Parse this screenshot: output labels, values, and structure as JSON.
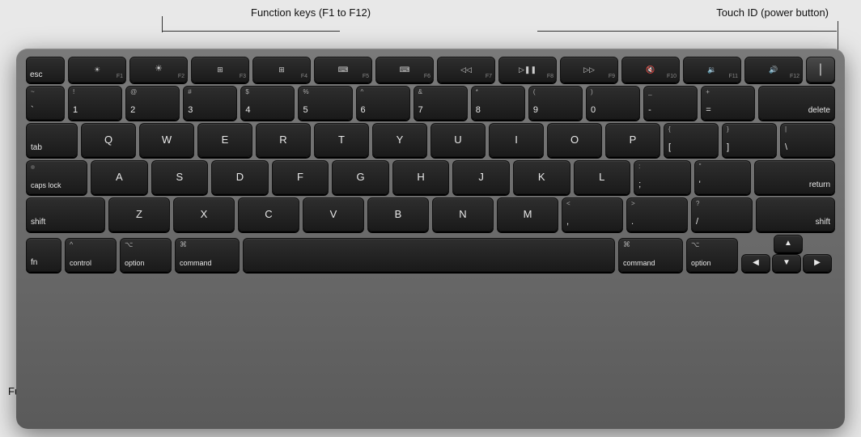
{
  "annotations": {
    "function_keys_label": "Function keys (F1 to F12)",
    "touchid_label": "Touch ID (power button)",
    "fn_key_label": "Function (Fn) key"
  },
  "keyboard": {
    "rows": {
      "fn_row": [
        "esc",
        "F1",
        "F2",
        "F3",
        "F4",
        "F5",
        "F6",
        "F7",
        "F8",
        "F9",
        "F10",
        "F11",
        "F12",
        "⏻"
      ],
      "num_row": [
        {
          "top": "~",
          "bottom": "`"
        },
        {
          "top": "!",
          "bottom": "1"
        },
        {
          "top": "@",
          "bottom": "2"
        },
        {
          "top": "#",
          "bottom": "3"
        },
        {
          "top": "$",
          "bottom": "4"
        },
        {
          "top": "%",
          "bottom": "5"
        },
        {
          "top": "^",
          "bottom": "6"
        },
        {
          "top": "&",
          "bottom": "7"
        },
        {
          "top": "*",
          "bottom": "8"
        },
        {
          "top": "(",
          "bottom": "9"
        },
        {
          "top": ")",
          "bottom": "0"
        },
        {
          "top": "_",
          "bottom": "-"
        },
        {
          "top": "+",
          "bottom": "="
        },
        "delete"
      ],
      "tab_row": [
        "tab",
        "Q",
        "W",
        "E",
        "R",
        "T",
        "Y",
        "U",
        "I",
        "O",
        "P",
        "{[",
        "}]",
        "|\\"
      ],
      "caps_row": [
        "caps lock",
        "A",
        "S",
        "D",
        "F",
        "G",
        "H",
        "J",
        "K",
        "L",
        ";:",
        "\"'",
        "return"
      ],
      "shift_row": [
        "shift",
        "Z",
        "X",
        "C",
        "V",
        "B",
        "N",
        "M",
        "<,",
        ">.",
        "?/",
        "shift"
      ],
      "bottom_row": [
        "fn",
        "control",
        "option",
        "command",
        "space",
        "command",
        "option",
        "←",
        "↑↓",
        "→"
      ]
    }
  }
}
